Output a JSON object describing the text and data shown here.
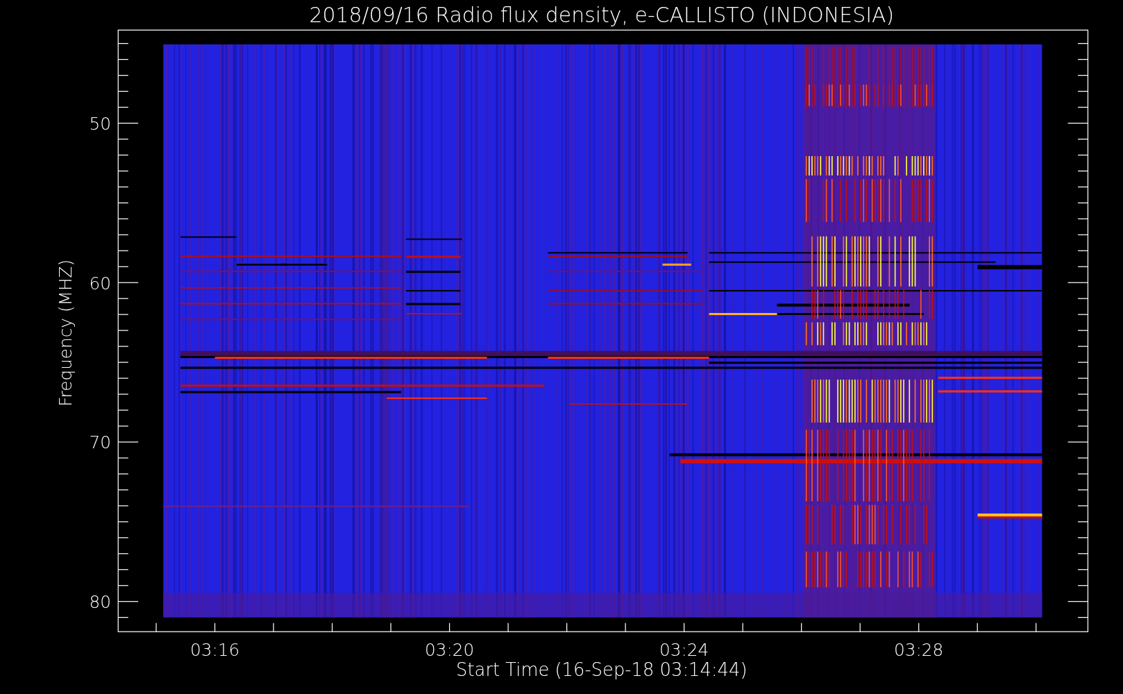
{
  "plot": {
    "title": "2018/09/16  Radio flux density, e-CALLISTO (INDONESIA)",
    "y_axis_label": "Frequency (MHZ)",
    "y_tick_labels": [
      "50",
      "60",
      "70",
      "80"
    ],
    "x_axis_label": "Start Time (16-Sep-18 03:14:44)",
    "x_tick_labels": [
      "03:16",
      "03:20",
      "03:24",
      "03:28"
    ]
  }
}
